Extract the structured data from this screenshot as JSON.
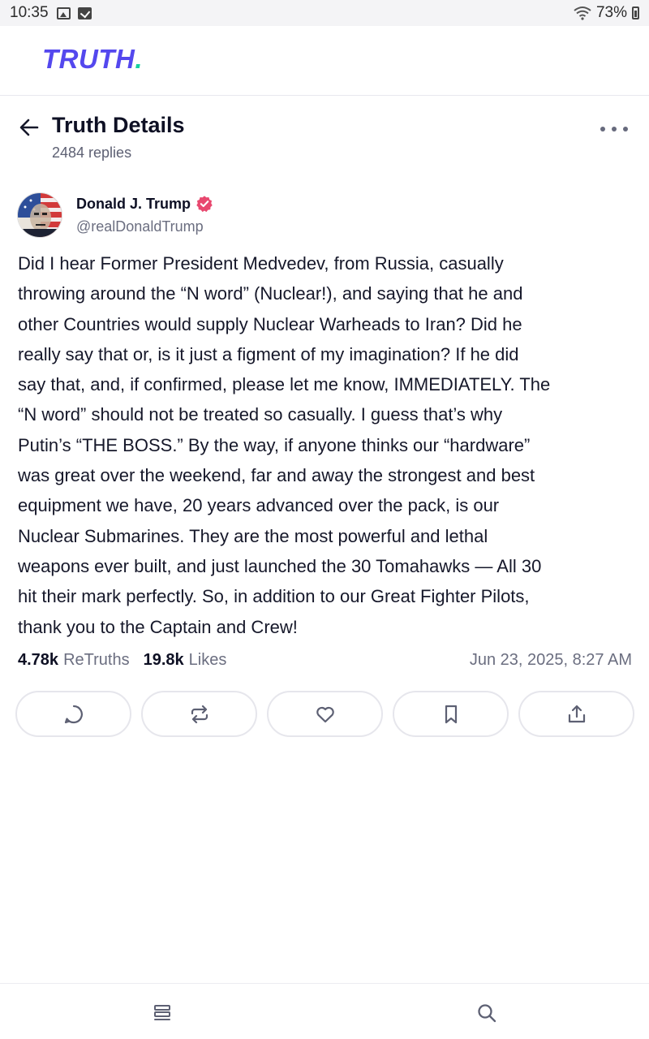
{
  "status_bar": {
    "time": "10:35",
    "battery": "73%"
  },
  "brand": {
    "logo_text": "TRUTH",
    "logo_dot": ".",
    "color": "#5448ee",
    "dot_color": "#17d1a0"
  },
  "header": {
    "title": "Truth Details",
    "replies": "2484 replies"
  },
  "post": {
    "author_name": "Donald J. Trump",
    "author_handle": "@realDonaldTrump",
    "verified_color": "#e8486f",
    "text": "Did I hear Former President Medvedev, from Russia, casually\nthrowing around the “N word” (Nuclear!), and saying that he and\nother Countries would supply Nuclear Warheads to Iran? Did he\nreally say that or, is it just a figment of my imagination? If he did\nsay that, and, if confirmed, please let me know, IMMEDIATELY. The\n“N word” should not be treated so casually. I guess that’s why\nPutin’s “THE BOSS.” By the way, if anyone thinks our “hardware”\nwas great over the weekend, far and away the strongest and best\nequipment we have, 20 years advanced over the pack, is our\nNuclear Submarines. They are the most powerful and lethal\nweapons ever built, and just launched the 30 Tomahawks — All 30\nhit their mark perfectly. So, in addition to our Great Fighter Pilots,\nthank you to the Captain and Crew!",
    "retruths_count": "4.78k",
    "retruths_label": "ReTruths",
    "likes_count": "19.8k",
    "likes_label": "Likes",
    "timestamp": "Jun 23, 2025, 8:27 AM"
  },
  "actions": [
    "reply-icon",
    "retruth-icon",
    "like-icon",
    "bookmark-icon",
    "share-icon"
  ],
  "bottom_nav": [
    "feed-icon",
    "search-icon"
  ]
}
